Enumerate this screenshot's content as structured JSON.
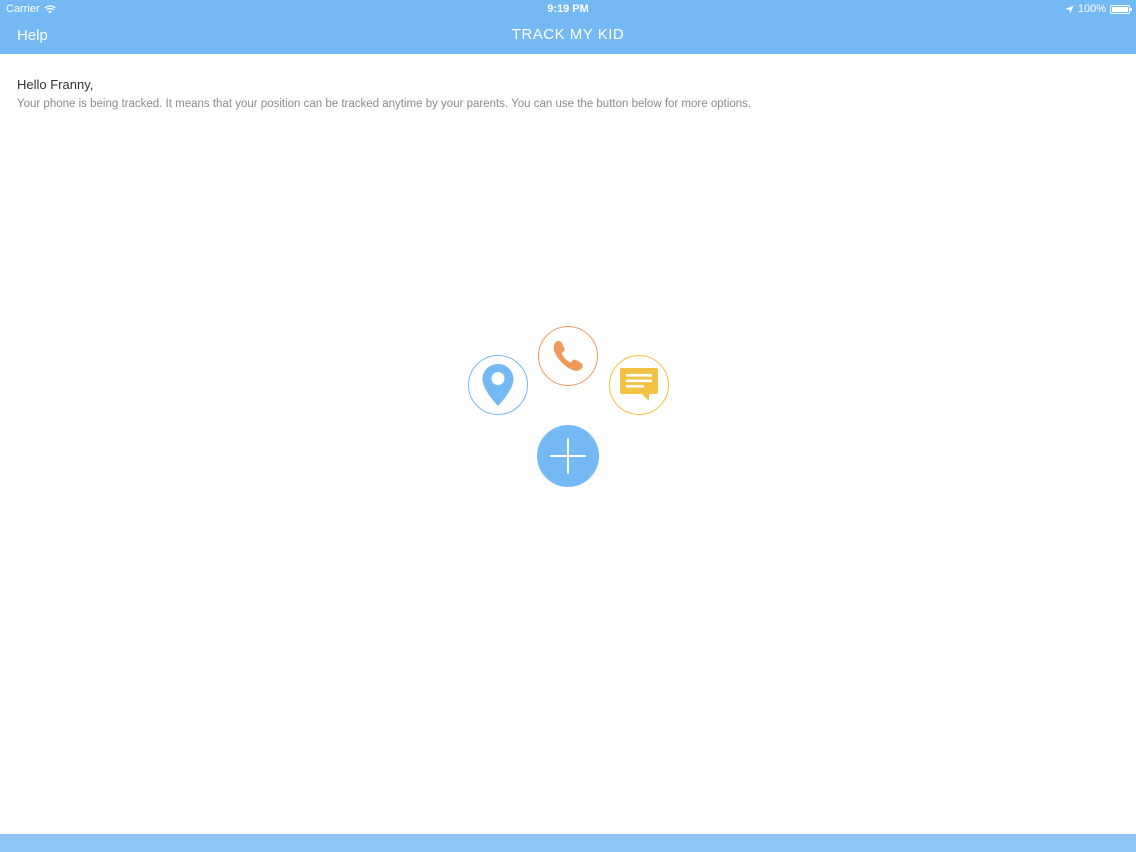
{
  "status_bar": {
    "carrier": "Carrier",
    "time": "9:19 PM",
    "battery": "100%"
  },
  "nav": {
    "help_label": "Help",
    "title": "TRACK MY KID"
  },
  "content": {
    "greeting": "Hello Franny,",
    "description": "Your phone is being tracked. It means that your position can be tracked anytime by your parents. You can use the button below for more options."
  },
  "colors": {
    "header": "#74b9f4",
    "location": "#74b9f4",
    "phone": "#ee9a5a",
    "message": "#f2c244",
    "plus": "#74b9f4"
  },
  "menu": {
    "items": [
      {
        "icon": "location-pin-icon"
      },
      {
        "icon": "phone-icon"
      },
      {
        "icon": "message-icon"
      },
      {
        "icon": "plus-icon"
      }
    ]
  }
}
